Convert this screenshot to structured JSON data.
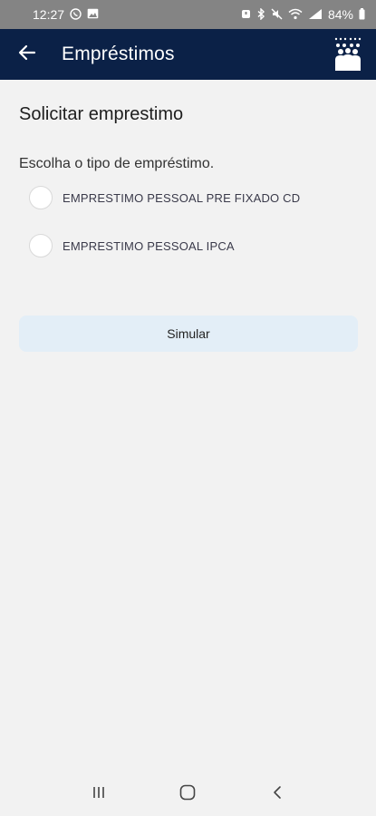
{
  "status_bar": {
    "time": "12:27",
    "battery": "84%",
    "left_icons": [
      "whatsapp-icon",
      "image-icon"
    ],
    "right_icons": [
      "alarm-icon",
      "bluetooth-icon",
      "mute-icon",
      "wifi-icon",
      "signal-icon",
      "battery-icon"
    ]
  },
  "app_bar": {
    "title": "Empréstimos",
    "back_icon": "arrow-left-icon",
    "logo_icon": "people-group-icon"
  },
  "main": {
    "heading": "Solicitar emprestimo",
    "question": "Escolha o tipo de empréstimo.",
    "options": [
      {
        "label": "EMPRESTIMO PESSOAL PRE FIXADO CD",
        "selected": false
      },
      {
        "label": "EMPRESTIMO PESSOAL IPCA",
        "selected": false
      }
    ],
    "simulate_label": "Simular"
  },
  "nav_bar": {
    "icons": [
      "recent-apps-icon",
      "home-icon",
      "back-icon"
    ]
  },
  "colors": {
    "app_bar": "#0b2147",
    "status_bar": "#848484",
    "background": "#f2f2f2",
    "button": "#e3eef7"
  }
}
